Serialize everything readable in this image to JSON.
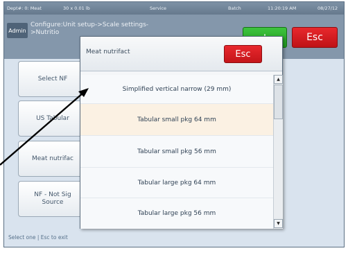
{
  "status_bar": {
    "dept": "Dept#: 0: Meat",
    "capacity": "30 x 0.01 lb",
    "mode": "Service",
    "batch": "Batch",
    "time": "11:20:19 AM",
    "date": "08/27/12"
  },
  "header": {
    "admin": "Admin",
    "breadcrumb_line1": "Configure:Unit setup->Scale settings-",
    "breadcrumb_line2": ">Nutritio",
    "plus_label": "+",
    "esc_label": "Esc"
  },
  "left_buttons": [
    {
      "label": "Select NF"
    },
    {
      "label": "US Tabular"
    },
    {
      "label": "Meat nutrifac"
    },
    {
      "label_line1": "NF - Not Sig",
      "label_line2": "Source"
    }
  ],
  "footer": {
    "hint": "Select one | Esc to exit"
  },
  "modal": {
    "title": "Meat nutrifact",
    "esc_label": "Esc",
    "items": [
      {
        "label": "Simplified vertical narrow (29 mm)"
      },
      {
        "label": "Tabular small pkg 64 mm"
      },
      {
        "label": "Tabular small pkg 56 mm"
      },
      {
        "label": "Tabular large pkg 64 mm"
      },
      {
        "label": "Tabular large pkg 56 mm"
      }
    ],
    "selected_index": 1
  },
  "icons": {
    "scroll_up": "scroll-up-arrow-icon",
    "scroll_down": "scroll-down-arrow-icon",
    "annotation": "pointer-arrow-icon"
  },
  "colors": {
    "esc_red": "#d91c21",
    "plus_green": "#2db02d",
    "header_blue": "#8497ab",
    "selected_row": "#fbf1e3"
  }
}
